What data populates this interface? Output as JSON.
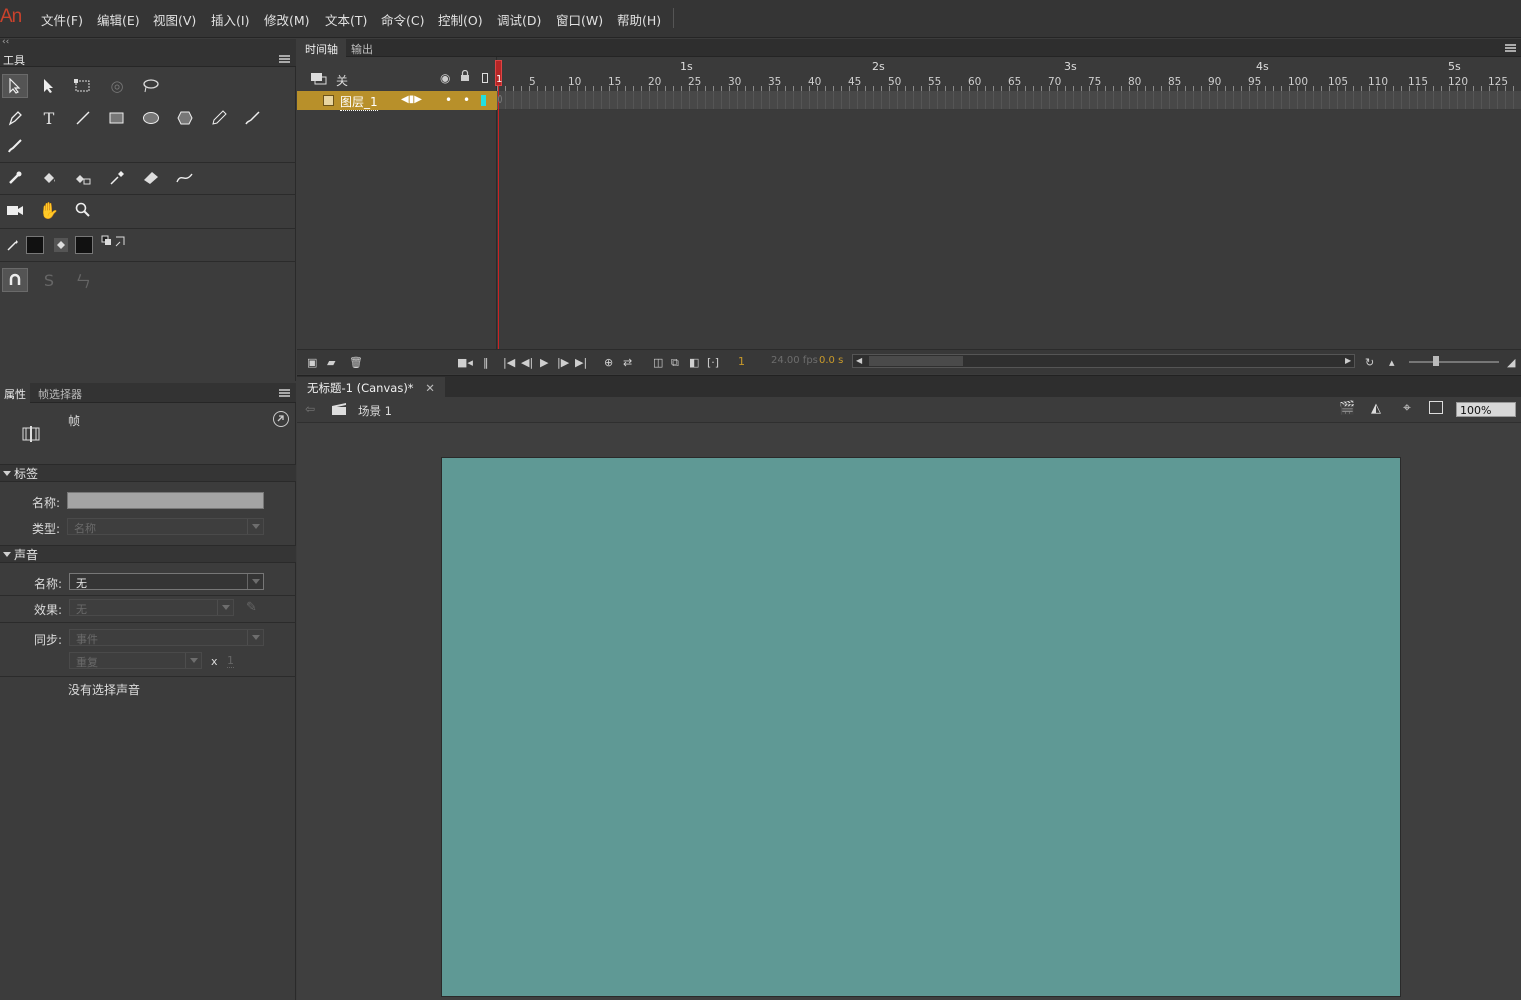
{
  "app": {
    "logo": "An"
  },
  "menu": [
    "文件(F)",
    "编辑(E)",
    "视图(V)",
    "插入(I)",
    "修改(M)",
    "文本(T)",
    "命令(C)",
    "控制(O)",
    "调试(D)",
    "窗口(W)",
    "帮助(H)"
  ],
  "tools_panel": {
    "title": "工具",
    "collapse": "‹‹"
  },
  "props_panel": {
    "tabs": [
      "属性",
      "帧选择器"
    ],
    "type_label": "帧",
    "label_section": {
      "title": "标签",
      "name_label": "名称:",
      "type_label": "类型:",
      "type_value": "名称"
    },
    "sound_section": {
      "title": "声音",
      "name_label": "名称:",
      "name_value": "无",
      "effect_label": "效果:",
      "effect_value": "无",
      "sync_label": "同步:",
      "sync_value": "事件",
      "repeat_value": "重复",
      "times_x": "x",
      "times_value": "1",
      "no_sound": "没有选择声音"
    }
  },
  "timeline": {
    "tabs": [
      "时间轴",
      "输出"
    ],
    "header_label": "关",
    "layer_name": "图层_1",
    "seconds": [
      "1s",
      "2s",
      "3s",
      "4s",
      "5s"
    ],
    "frame_numbers": [
      "1",
      "5",
      "10",
      "15",
      "20",
      "25",
      "30",
      "35",
      "40",
      "45",
      "50",
      "55",
      "60",
      "65",
      "70",
      "75",
      "80",
      "85",
      "90",
      "95",
      "100",
      "105",
      "110",
      "115",
      "120",
      "125"
    ],
    "current_frame": "1",
    "fps": "24.00 fps",
    "elapsed": "0.0 s"
  },
  "document": {
    "tab_title": "无标题-1 (Canvas)*",
    "scene": "场景 1",
    "zoom": "100%",
    "stage_color": "#5f9995"
  }
}
